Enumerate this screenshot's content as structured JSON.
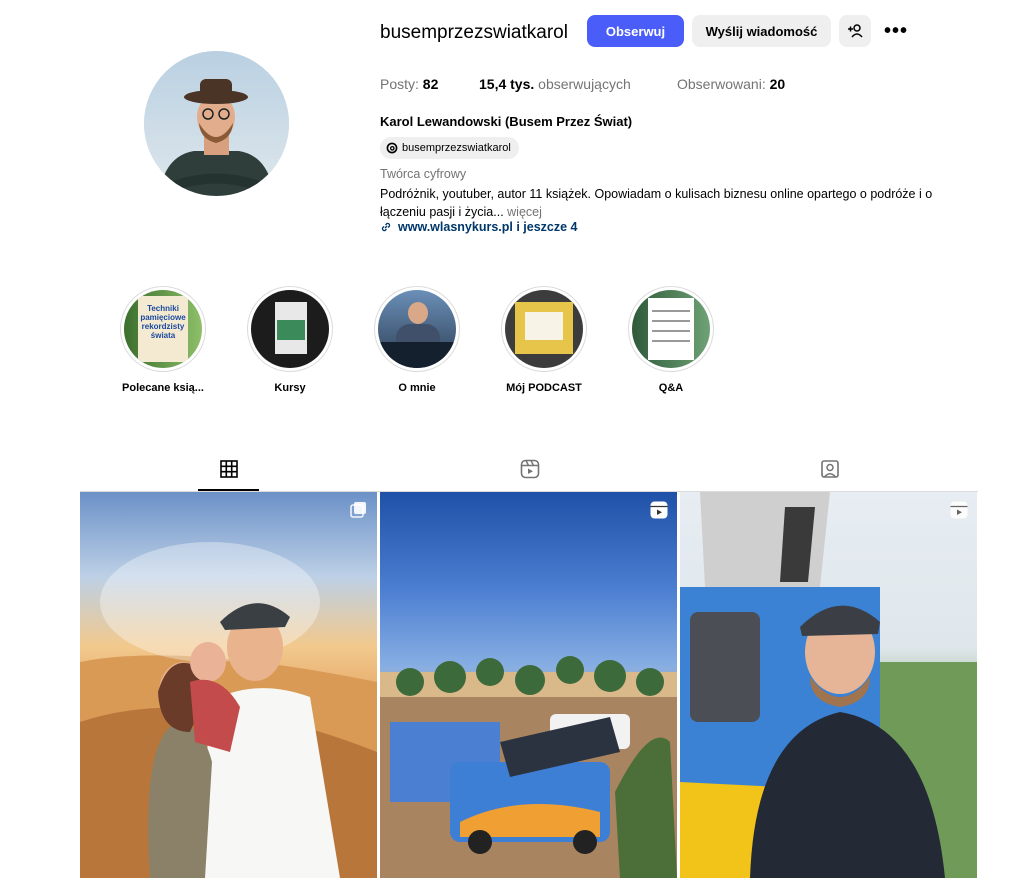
{
  "profile": {
    "username": "busemprzezswiatkarol",
    "follow_label": "Obserwuj",
    "message_label": "Wyślij wiadomość",
    "more_label": "•••",
    "stats": {
      "posts_label": "Posty:",
      "posts_value": "82",
      "followers_value": "15,4 tys.",
      "followers_label": "obserwujących",
      "following_label": "Obserwowani:",
      "following_value": "20"
    },
    "full_name": "Karol Lewandowski (Busem Przez Świat)",
    "threads_handle": "busemprzezswiatkarol",
    "category": "Twórca cyfrowy",
    "bio_text": "Podróżnik, youtuber, autor 11 książek. Opowiadam o kulisach biznesu online opartego o podróże i o łączeniu pasji i życia...",
    "bio_more": "więcej",
    "link_text": "www.wlasnykurs.pl i jeszcze 4"
  },
  "highlights": [
    {
      "label": "Polecane ksią..."
    },
    {
      "label": "Kursy"
    },
    {
      "label": "O mnie"
    },
    {
      "label": "Mój PODCAST"
    },
    {
      "label": "Q&A"
    }
  ],
  "highlight_texts": {
    "book_title": "Techniki pamięciowe rekordzisty świata"
  },
  "tabs": [
    {
      "icon": "grid-icon",
      "active": true
    },
    {
      "icon": "reels-icon",
      "active": false
    },
    {
      "icon": "tagged-icon",
      "active": false
    }
  ],
  "posts": [
    {
      "type": "carousel",
      "scene": "desert selfie family"
    },
    {
      "type": "reel",
      "scene": "van at desert camp"
    },
    {
      "type": "reel",
      "scene": "man in front of van"
    }
  ],
  "colors": {
    "accent": "#4a5df9",
    "button_bg": "#efefef",
    "muted": "#737373",
    "link": "#00376b"
  }
}
